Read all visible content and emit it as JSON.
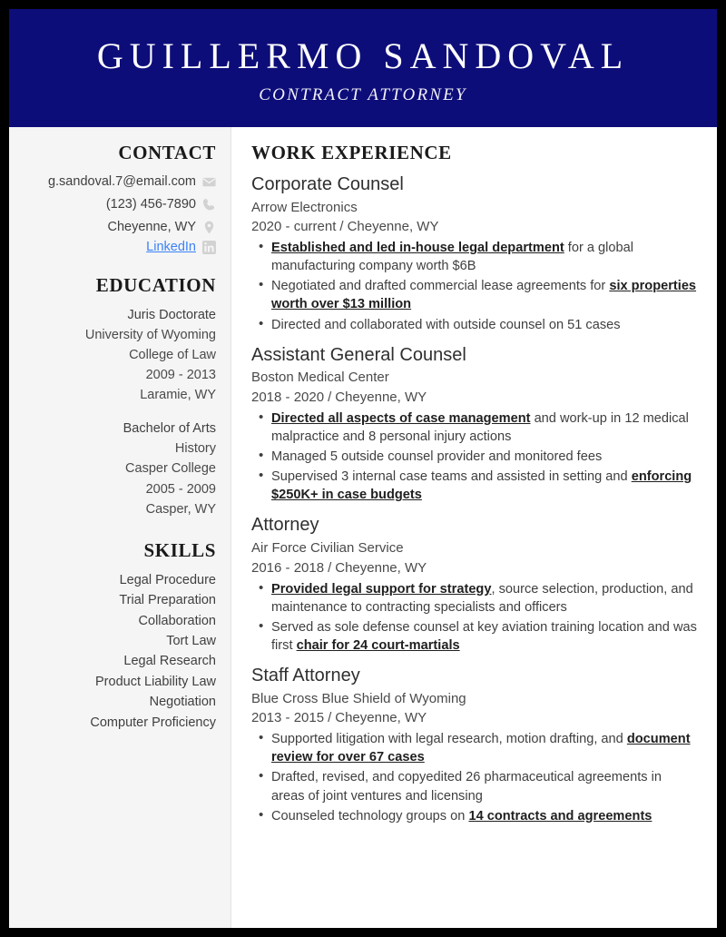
{
  "header": {
    "name": "GUILLERMO SANDOVAL",
    "job_title": "CONTRACT ATTORNEY",
    "background_color": "#0d0d7a"
  },
  "sidebar": {
    "contact": {
      "heading": "CONTACT",
      "items": [
        {
          "text": "g.sandoval.7@email.com",
          "icon": "envelope-icon",
          "link": false
        },
        {
          "text": "(123) 456-7890",
          "icon": "phone-icon",
          "link": false
        },
        {
          "text": "Cheyenne, WY",
          "icon": "location-pin-icon",
          "link": false
        },
        {
          "text": "LinkedIn",
          "icon": "linkedin-icon",
          "link": true
        }
      ],
      "link_color": "#3b82f6"
    },
    "education": {
      "heading": "EDUCATION",
      "entries": [
        {
          "degree": "Juris Doctorate",
          "school_line1": "University of Wyoming",
          "school_line2": "College of Law",
          "years": "2009 - 2013",
          "location": "Laramie, WY"
        },
        {
          "degree": "Bachelor of Arts",
          "school_line1": "History",
          "school_line2": "Casper College",
          "years": "2005 - 2009",
          "location": "Casper, WY"
        }
      ]
    },
    "skills": {
      "heading": "SKILLS",
      "items": [
        "Legal Procedure",
        "Trial Preparation",
        "Collaboration",
        "Tort Law",
        "Legal Research",
        "Product Liability Law",
        "Negotiation",
        "Computer Proficiency"
      ]
    }
  },
  "main": {
    "heading": "WORK EXPERIENCE",
    "jobs": [
      {
        "title": "Corporate Counsel",
        "company": "Arrow Electronics",
        "years": "2020 - current",
        "location": "Cheyenne, WY",
        "bullets": [
          {
            "bold": "Established and led in-house legal department",
            "rest": " for a global manufacturing company worth $6B",
            "bold_first": true
          },
          {
            "lead": "Negotiated and drafted commercial lease agreements for ",
            "bold": "six properties worth over $13 million",
            "bold_first": false
          },
          {
            "lead": "Directed and collaborated with outside counsel on 51 cases",
            "bold": "",
            "bold_first": false
          }
        ]
      },
      {
        "title": "Assistant General Counsel",
        "company": "Boston Medical Center",
        "years": "2018 - 2020",
        "location": "Cheyenne, WY",
        "bullets": [
          {
            "bold": "Directed all aspects of case management",
            "rest": " and work-up in 12 medical malpractice and 8 personal injury actions",
            "bold_first": true
          },
          {
            "lead": "Managed 5 outside counsel provider and monitored fees",
            "bold": "",
            "bold_first": false
          },
          {
            "lead": "Supervised 3 internal case teams and assisted in setting and ",
            "bold": "enforcing $250K+ in case budgets",
            "bold_first": false
          }
        ]
      },
      {
        "title": "Attorney",
        "company": "Air Force Civilian Service",
        "years": "2016 - 2018",
        "location": "Cheyenne, WY",
        "bullets": [
          {
            "bold": "Provided legal support for strategy",
            "rest": ", source selection, production, and maintenance to contracting specialists and officers",
            "bold_first": true
          },
          {
            "lead": "Served as sole defense counsel at key aviation training location and was first ",
            "bold": "chair for 24 court-martials",
            "bold_first": false
          }
        ]
      },
      {
        "title": "Staff Attorney",
        "company": "Blue Cross Blue Shield of Wyoming",
        "years": "2013 - 2015",
        "location": "Cheyenne, WY",
        "bullets": [
          {
            "lead": "Supported litigation with legal research, motion drafting, and ",
            "bold": "document review for over 67 cases",
            "bold_first": false
          },
          {
            "lead": "Drafted, revised, and copyedited 26 pharmaceutical agreements in areas of joint ventures and licensing",
            "bold": "",
            "bold_first": false
          },
          {
            "lead": "Counseled technology groups on ",
            "bold": "14 contracts and agreements",
            "bold_first": false
          }
        ]
      }
    ]
  }
}
